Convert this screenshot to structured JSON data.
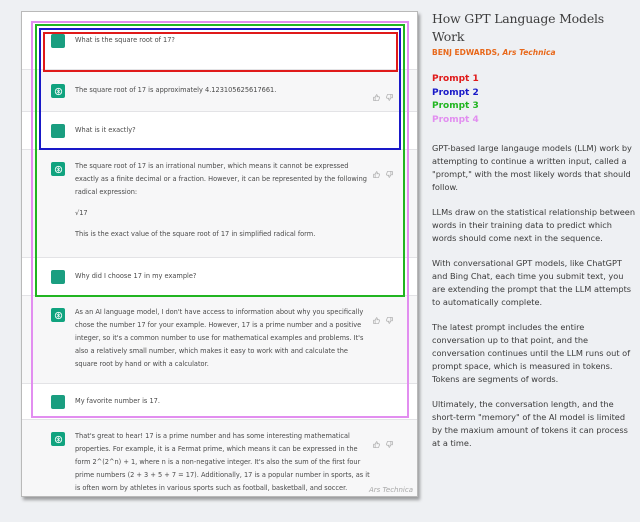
{
  "conversation": {
    "messages": [
      {
        "role": "user",
        "paragraphs": [
          "What is the square root of 17?"
        ]
      },
      {
        "role": "assistant",
        "paragraphs": [
          "The square root of 17 is approximately 4.123105625617661."
        ]
      },
      {
        "role": "user",
        "paragraphs": [
          "What is it exactly?"
        ]
      },
      {
        "role": "assistant",
        "paragraphs": [
          "The square root of 17 is an irrational number, which means it cannot be expressed exactly as a finite decimal or a fraction. However, it can be represented by the following radical expression:",
          "√17",
          "This is the exact value of the square root of 17 in simplified radical form."
        ]
      },
      {
        "role": "user",
        "paragraphs": [
          "Why did I choose 17 in my example?"
        ]
      },
      {
        "role": "assistant",
        "paragraphs": [
          "As an AI language model, I don't have access to information about why you specifically chose the number 17 for your example. However, 17 is a prime number and a positive integer, so it's a common number to use for mathematical examples and problems. It's also a relatively small number, which makes it easy to work with and calculate the square root by hand or with a calculator."
        ]
      },
      {
        "role": "user",
        "paragraphs": [
          "My favorite number is 17."
        ]
      },
      {
        "role": "assistant",
        "paragraphs": [
          "That's great to hear! 17 is a prime number and has some interesting mathematical properties. For example, it is a Fermat prime, which means it can be expressed in the form 2^(2^n) + 1, where n is a non-negative integer. It's also the sum of the first four prime numbers (2 + 3 + 5 + 7 = 17). Additionally, 17 is a popular number in sports, as it is often worn by athletes in various sports such as football, basketball, and soccer."
        ]
      }
    ],
    "feedback_icons": [
      "thumbs-up-icon",
      "thumbs-down-icon"
    ],
    "watermark": "Ars Technica"
  },
  "sidebar": {
    "title": "How GPT Language Models Work",
    "byline_author": "BENJ EDWARDS, ",
    "byline_outlet": "Ars Technica",
    "legend": [
      {
        "label": "Prompt 1",
        "color": "#e01a1a"
      },
      {
        "label": "Prompt 2",
        "color": "#1919c8"
      },
      {
        "label": "Prompt 3",
        "color": "#21b521"
      },
      {
        "label": "Prompt 4",
        "color": "#e28ef0"
      }
    ],
    "paragraphs": [
      "GPT-based large langauge models (LLM) work by attempting to continue a written input, called a \"prompt,\" with the most likely words that should follow.",
      "LLMs draw on the statistical relationship between words in their training data to predict which words should come next in the sequence.",
      "With conversational GPT models, like ChatGPT and Bing Chat, each time you submit text, you are extending the prompt that the LLM attempts to automatically complete.",
      "The latest prompt includes the entire conversation up to that point, and the conversation continues until the LLM runs out of prompt space, which is measured in tokens. Tokens are segments of words.",
      "Ultimately, the conversation length, and the short-term \"memory\" of the AI model is limited by the maxium amount of tokens it can process at a time."
    ]
  },
  "colors": {
    "accent": "#10a37f",
    "byline": "#e8681a"
  }
}
